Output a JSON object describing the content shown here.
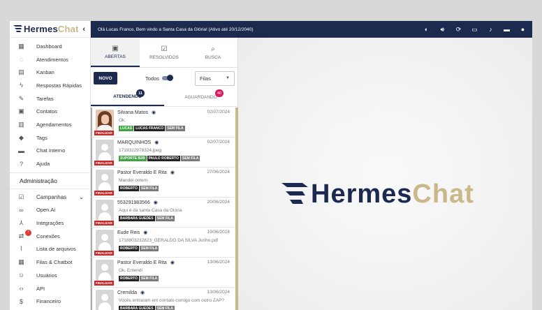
{
  "brand": {
    "part1": "Hermes",
    "part2": "Chat"
  },
  "topbar": {
    "welcome": "Olá Lucas Franco, Bem vindo a Santa Casa da Glória! (Ativo até 20/12/2040)"
  },
  "sidebar": {
    "items": [
      {
        "label": "Dashboard",
        "icon": "dashboard-icon"
      },
      {
        "label": "Atendimentos",
        "icon": "whatsapp-icon"
      },
      {
        "label": "Kanban",
        "icon": "kanban-icon"
      },
      {
        "label": "Respostas Rápidas",
        "icon": "bolt-icon"
      },
      {
        "label": "Tarefas",
        "icon": "pencil-icon"
      },
      {
        "label": "Contatos",
        "icon": "contacts-icon"
      },
      {
        "label": "Agendamentos",
        "icon": "calendar-icon"
      },
      {
        "label": "Tags",
        "icon": "tag-icon"
      },
      {
        "label": "Chat Interno",
        "icon": "chat-icon"
      },
      {
        "label": "Ajuda",
        "icon": "help-icon"
      }
    ],
    "section": "Administração",
    "admin_items": [
      {
        "label": "Campanhas",
        "icon": "campaign-icon"
      },
      {
        "label": "Open.Ai",
        "icon": "openai-icon"
      },
      {
        "label": "Integrações",
        "icon": "integrations-icon"
      },
      {
        "label": "Conexões",
        "icon": "connections-icon",
        "badge": "!"
      },
      {
        "label": "Lista de arquivos",
        "icon": "attachment-icon"
      },
      {
        "label": "Filas & Chatbot",
        "icon": "queue-icon"
      },
      {
        "label": "Usuários",
        "icon": "users-icon"
      },
      {
        "label": "API",
        "icon": "code-icon"
      },
      {
        "label": "Financeiro",
        "icon": "money-icon"
      }
    ]
  },
  "tickets": {
    "tabs": [
      {
        "label": "ABERTAS",
        "icon": "inbox-icon"
      },
      {
        "label": "RESOLVIDOS",
        "icon": "check-box-icon"
      },
      {
        "label": "BUSCA",
        "icon": "search-icon"
      }
    ],
    "new_button": "NOVO",
    "todos_label": "Todos",
    "filas_label": "Filas",
    "subtabs": [
      {
        "label": "ATENDENDO",
        "count": "11",
        "color": "#1c2a4f"
      },
      {
        "label": "AGUARDANDO",
        "count": "40",
        "color": "#d81b60"
      }
    ],
    "finalize_label": "FINALIZAR",
    "rows": [
      {
        "name": "Silvana Matos",
        "date": "02/07/2024",
        "msg": "Ok.",
        "photo": true,
        "tags": [
          {
            "t": "LUCAS",
            "c": "#43a047"
          },
          {
            "t": "LUCAS FRANCO",
            "c": "#222222"
          },
          {
            "t": "SEM FILA",
            "c": "#7a7a7a"
          }
        ]
      },
      {
        "name": "MARQUINHOS",
        "date": "02/07/2024",
        "msg": "1719322978324.jpeg",
        "photo": false,
        "tags": [
          {
            "t": "SUPORTE B2B",
            "c": "#43a047"
          },
          {
            "t": "PAULO ROBERTO",
            "c": "#222222"
          },
          {
            "t": "SEM FILA",
            "c": "#7a7a7a"
          }
        ]
      },
      {
        "name": "Pastor Everaldo E Rita",
        "date": "27/06/2024",
        "msg": "Mandei ontem",
        "photo": false,
        "tags": [
          {
            "t": "ROBERTO",
            "c": "#222222"
          },
          {
            "t": "SEM FILA",
            "c": "#7a7a7a"
          }
        ]
      },
      {
        "name": "553291983566",
        "date": "20/06/2024",
        "msg": "Aqui é da santa Casa da Glória",
        "photo": false,
        "tags": [
          {
            "t": "BARBARA GUEDES",
            "c": "#222222"
          },
          {
            "t": "SEM FILA",
            "c": "#7a7a7a"
          }
        ]
      },
      {
        "name": "Eude Reis",
        "date": "19/06/2024",
        "msg": "1718803232823_GERALDO DA SILVA Junho.pdf",
        "photo": false,
        "tags": [
          {
            "t": "ROBERTO",
            "c": "#222222"
          },
          {
            "t": "SEM FILA",
            "c": "#7a7a7a"
          }
        ]
      },
      {
        "name": "Pastor Everaldo E Rita",
        "date": "13/06/2024",
        "msg": "Ok. Entendi",
        "photo": false,
        "tags": [
          {
            "t": "ROBERTO",
            "c": "#222222"
          },
          {
            "t": "SEM FILA",
            "c": "#7a7a7a"
          }
        ]
      },
      {
        "name": "Cremilda",
        "date": "13/06/2024",
        "msg": "Vocês entraram em contato comigo com outro ZAP?",
        "photo": false,
        "tags": [
          {
            "t": "BARBARA GUEDES",
            "c": "#222222"
          },
          {
            "t": "SEM FILA",
            "c": "#7a7a7a"
          }
        ]
      }
    ]
  },
  "main_logo": {
    "part1": "Hermes",
    "part2": "Chat"
  },
  "colors": {
    "primary": "#1c2a4f",
    "gold": "#c9b98a",
    "danger": "#c62828"
  }
}
